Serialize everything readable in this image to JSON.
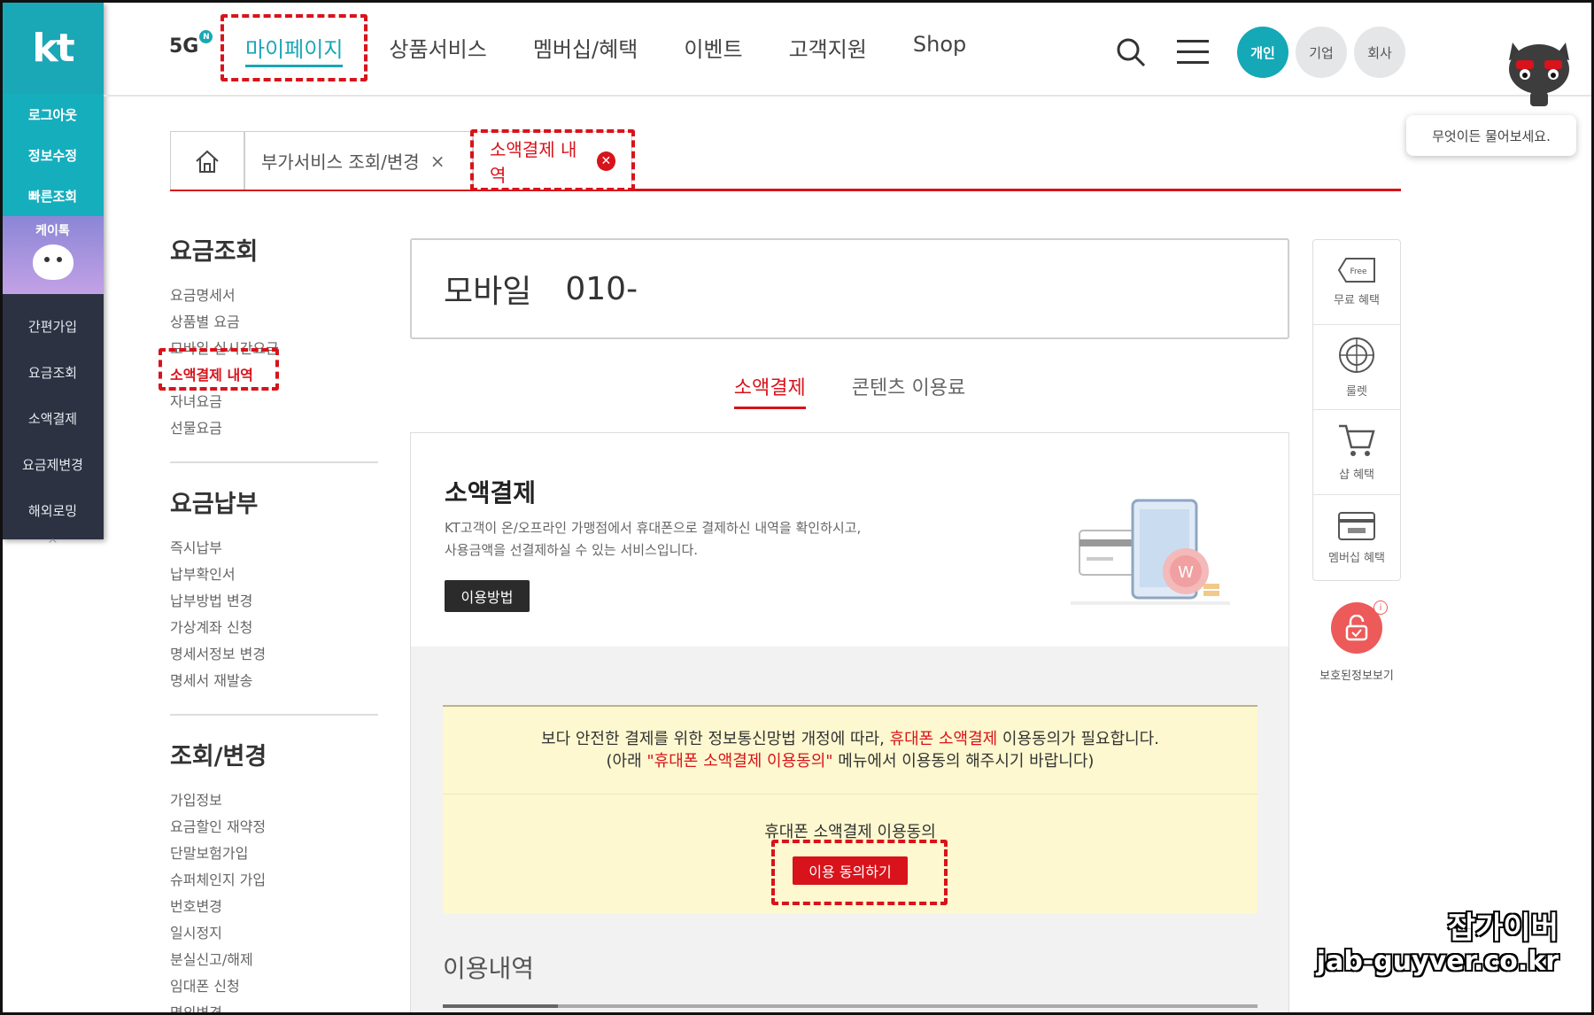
{
  "quickbar": {
    "logo": "kt",
    "top_items": [
      "로그아웃",
      "정보수정",
      "빠른조회"
    ],
    "character_label": "케이톡",
    "items": [
      "간편가입",
      "요금조회",
      "소액결제",
      "요금제변경",
      "해외로밍"
    ],
    "up_arrow": "^"
  },
  "header": {
    "logo": "5G",
    "nav": [
      "마이페이지",
      "상품서비스",
      "멤버십/혜택",
      "이벤트",
      "고객지원",
      "Shop"
    ],
    "active_nav": "마이페이지",
    "segments": [
      "개인",
      "기업",
      "회사"
    ],
    "icons": [
      "search-icon",
      "menu-icon"
    ],
    "chatbot_prompt": "무엇이든 물어보세요."
  },
  "tabs": {
    "service_tab": "부가서비스 조회/변경",
    "close_glyph": "×",
    "current_tab": "소액결제 내역",
    "current_close_glyph": "✕"
  },
  "lnb": {
    "groups": [
      {
        "title": "요금조회",
        "items": [
          "요금명세서",
          "상품별 요금",
          "모바일 실시간요금",
          "소액결제 내역",
          "자녀요금",
          "선물요금"
        ]
      },
      {
        "title": "요금납부",
        "items": [
          "즉시납부",
          "납부확인서",
          "납부방법 변경",
          "가상계좌 신청",
          "명세서정보 변경",
          "명세서 재발송"
        ]
      },
      {
        "title": "조회/변경",
        "items": [
          "가입정보",
          "요금할인 재약정",
          "단말보험가입",
          "슈퍼체인지 가입",
          "번호변경",
          "일시정지",
          "분실신고/해제",
          "임대폰 신청",
          "명의변경"
        ]
      }
    ],
    "active_item": "소액결제 내역"
  },
  "main": {
    "line_type": "모바일",
    "phone_number": "010-",
    "subtabs": [
      "소액결제",
      "콘텐츠 이용료"
    ],
    "card": {
      "title": "소액결제",
      "desc_line1": "KT고객이 온/오프라인 가맹점에서 휴대폰으로 결제하신 내역을 확인하시고,",
      "desc_line2": "사용금액을 선결제하실 수 있는 서비스입니다.",
      "howto_button": "이용방법"
    },
    "notice": {
      "l1_a": "보다 안전한 결제를 위한 정보통신망법 개정에 따라, ",
      "l1_b": "휴대폰 소액결제",
      "l1_c": " 이용동의가 필요합니다.",
      "l2_a": "(아래 ",
      "l2_b": "\"휴대폰 소액결제 이용동의\"",
      "l2_c": " 메뉴에서 이용동의 해주시기 바랍니다)"
    },
    "consent": {
      "label": "휴대폰 소액결제 이용동의",
      "button": "이용 동의하기"
    },
    "history_title": "이용내역"
  },
  "right_quick": {
    "items": [
      "무료 혜택",
      "룰렛",
      "샵 혜택",
      "멤버십 혜택"
    ],
    "free_tag": "Free",
    "protect_label": "보호된정보보기",
    "protect_info": "i"
  },
  "watermark": {
    "line1": "잡가이버",
    "line2": "jab-guyver.co.kr"
  },
  "colors": {
    "brand": "#1aa7b6",
    "accent": "#d8131b",
    "notice_bg": "#fdf8cf"
  }
}
